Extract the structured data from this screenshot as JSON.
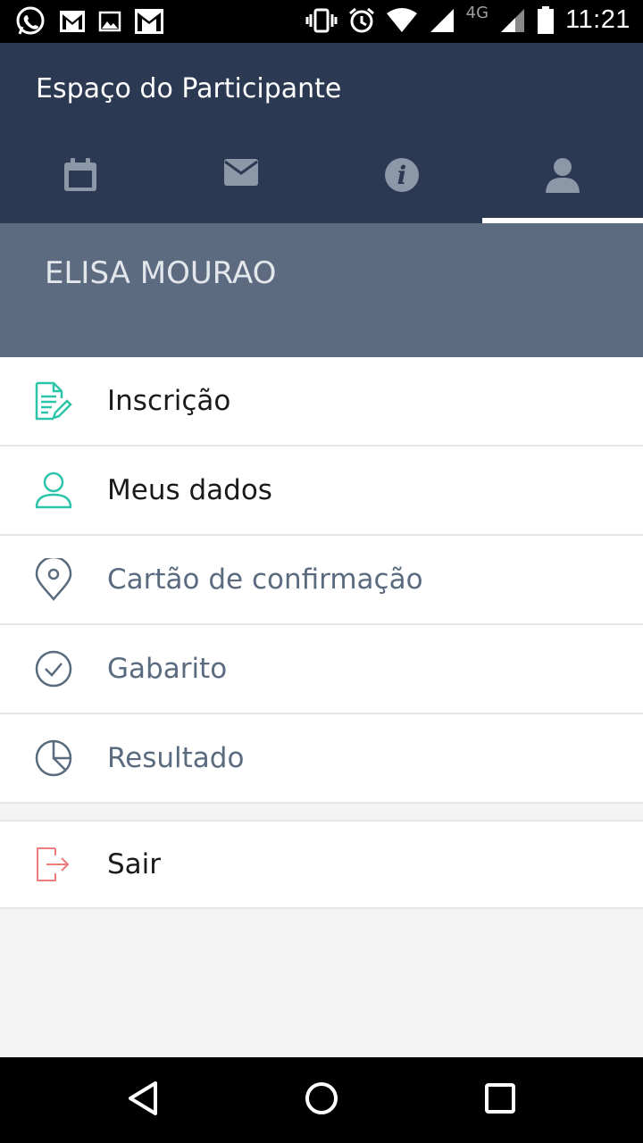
{
  "status_bar": {
    "left_icons": [
      "whatsapp-icon",
      "gmail-icon",
      "image-icon",
      "gmail-icon"
    ],
    "right_icons": [
      "vibrate-icon",
      "alarm-icon",
      "wifi-icon",
      "signal-icon",
      "signal-icon",
      "battery-icon"
    ],
    "network": "4G",
    "time": "11:21"
  },
  "app_bar": {
    "title": "Espaço do Participante",
    "background": "#2b3a52",
    "tabs": [
      {
        "icon": "calendar-icon",
        "active": false
      },
      {
        "icon": "envelope-icon",
        "active": false
      },
      {
        "icon": "info-icon",
        "active": false
      },
      {
        "icon": "user-icon",
        "active": true
      }
    ]
  },
  "profile": {
    "name": "ELISA MOURAO",
    "background": "#5d6b80"
  },
  "menu": {
    "items": [
      {
        "label": "Inscrição",
        "icon": "edit-document-icon",
        "icon_color": "#2ec4a9",
        "enabled": true
      },
      {
        "label": "Meus dados",
        "icon": "user-outline-icon",
        "icon_color": "#2ec4a9",
        "enabled": true
      },
      {
        "label": "Cartão de confirmação",
        "icon": "map-pin-icon",
        "icon_color": "#5b6b7f",
        "enabled": false
      },
      {
        "label": "Gabarito",
        "icon": "check-circle-icon",
        "icon_color": "#5b6b7f",
        "enabled": false
      },
      {
        "label": "Resultado",
        "icon": "pie-chart-icon",
        "icon_color": "#5b6b7f",
        "enabled": false
      }
    ],
    "logout": {
      "label": "Sair",
      "icon": "logout-icon",
      "icon_color": "#ee7c7c"
    }
  },
  "nav_bar": {
    "buttons": [
      "back-icon",
      "home-icon",
      "recents-icon"
    ]
  }
}
